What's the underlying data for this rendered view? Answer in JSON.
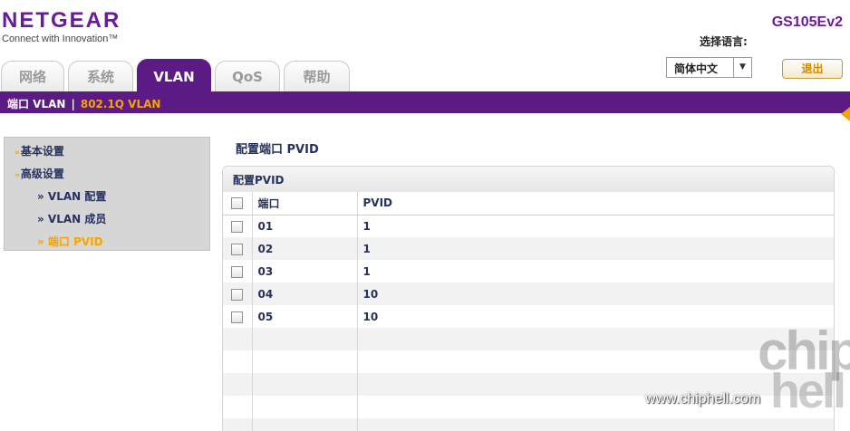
{
  "brand": {
    "name": "NETGEAR",
    "tagline": "Connect with Innovation™"
  },
  "model": "GS105Ev2",
  "language": {
    "label": "选择语言:",
    "selected": "简体中文"
  },
  "logout_label": "退出",
  "tabs": [
    {
      "label": "网络",
      "active": false
    },
    {
      "label": "系统",
      "active": false
    },
    {
      "label": "VLAN",
      "active": true
    },
    {
      "label": "QoS",
      "active": false
    },
    {
      "label": "帮助",
      "active": false
    }
  ],
  "subnav": {
    "first": "端口 VLAN",
    "separator": "|",
    "current": "802.1Q VLAN"
  },
  "sidebar": {
    "items": [
      {
        "label": "基本设置",
        "bullet": "»"
      },
      {
        "label": "高级设置",
        "bullet": "»"
      },
      {
        "label": "» VLAN 配置"
      },
      {
        "label": "» VLAN 成员"
      },
      {
        "label": "» 端口 PVID"
      }
    ]
  },
  "main": {
    "title": "配置端口 PVID",
    "panel_title": "配置PVID",
    "columns": [
      "端口",
      "PVID"
    ],
    "rows": [
      {
        "port": "01",
        "pvid": "1"
      },
      {
        "port": "02",
        "pvid": "1"
      },
      {
        "port": "03",
        "pvid": "1"
      },
      {
        "port": "04",
        "pvid": "10"
      },
      {
        "port": "05",
        "pvid": "10"
      }
    ]
  },
  "watermark": {
    "url": "www.chiphell.com",
    "logo_top": "chip",
    "logo_bottom": "hell"
  },
  "colors": {
    "brand_purple": "#5b1a84",
    "accent_orange": "#f7a400",
    "text_navy": "#26315e"
  }
}
